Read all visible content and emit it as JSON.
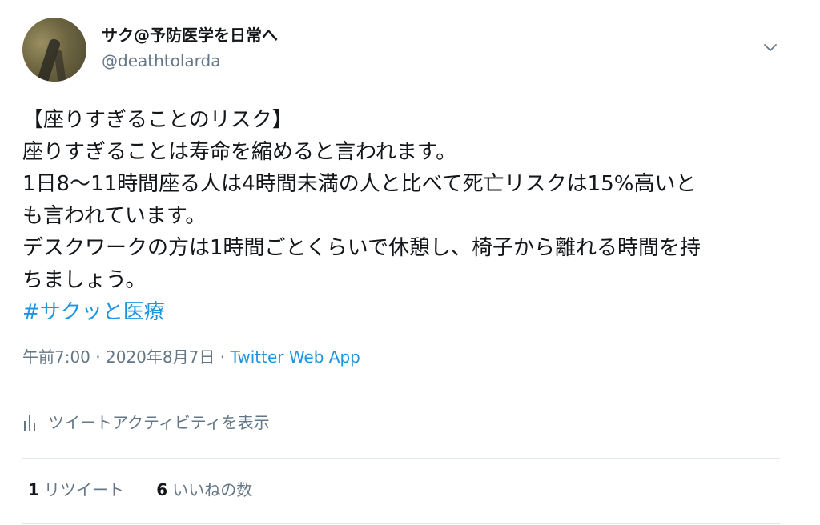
{
  "author": {
    "display_name": "サク@予防医学を日常へ",
    "handle": "@deathtolarda",
    "avatar_icon": "avatar-photo"
  },
  "tweet": {
    "lines": [
      "【座りすぎることのリスク】",
      "座りすぎることは寿命を縮めると言われます。",
      "1日8〜11時間座る人は4時間未満の人と比べて死亡リスクは15%高いと",
      "も言われています。",
      "デスクワークの方は1時間ごとくらいで休憩し、椅子から離れる時間を持",
      "ちましょう。"
    ],
    "hashtag": "#サクッと医療"
  },
  "meta": {
    "time": "午前7:00",
    "separator": "·",
    "date": "2020年8月7日",
    "source": "Twitter Web App"
  },
  "activity": {
    "label": "ツイートアクティビティを表示",
    "icon": "bar-chart-icon"
  },
  "stats": {
    "retweets_count": "1",
    "retweets_label": "リツイート",
    "likes_count": "6",
    "likes_label": "いいねの数"
  },
  "colors": {
    "link": "#1b95e0",
    "secondary_text": "#657786",
    "primary_text": "#14171a",
    "divider": "#e1e8ed"
  }
}
